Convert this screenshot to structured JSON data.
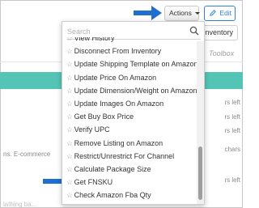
{
  "header": {
    "actions_label": "Actions",
    "edit_label": "Edit"
  },
  "background": {
    "inventory_label": "Inventory",
    "toolbox_label": "Toolbox",
    "chars_left_1": "rs left",
    "chars_left_2": "rs left",
    "chars_left_3": "rs left",
    "chars_left_4": "chars",
    "chars_left_5": "rs left",
    "snippet_1": "ns. E-commerce",
    "snippet_2": "lathing ba...",
    "teal_color": "#54c4b4"
  },
  "dropdown": {
    "search_placeholder": "Search",
    "items": [
      {
        "label": "View History"
      },
      {
        "label": "Disconnect From Inventory"
      },
      {
        "label": "Update Shipping Template on Amazon"
      },
      {
        "label": "Update Price On Amazon"
      },
      {
        "label": "Update Dimension/Weight on Amazon"
      },
      {
        "label": "Update Images On Amazon"
      },
      {
        "label": "Get Buy Box Price"
      },
      {
        "label": "Verify UPC"
      },
      {
        "label": "Remove Listing on Amazon"
      },
      {
        "label": "Restrict/Unrestrict For Channel"
      },
      {
        "label": "Calculate Package Size"
      },
      {
        "label": "Get FNSKU"
      },
      {
        "label": "Check Amazon Fba Qty"
      }
    ],
    "star_glyph": "☆"
  },
  "colors": {
    "accent": "#2f83d6",
    "arrow": "#1f6fd1"
  }
}
